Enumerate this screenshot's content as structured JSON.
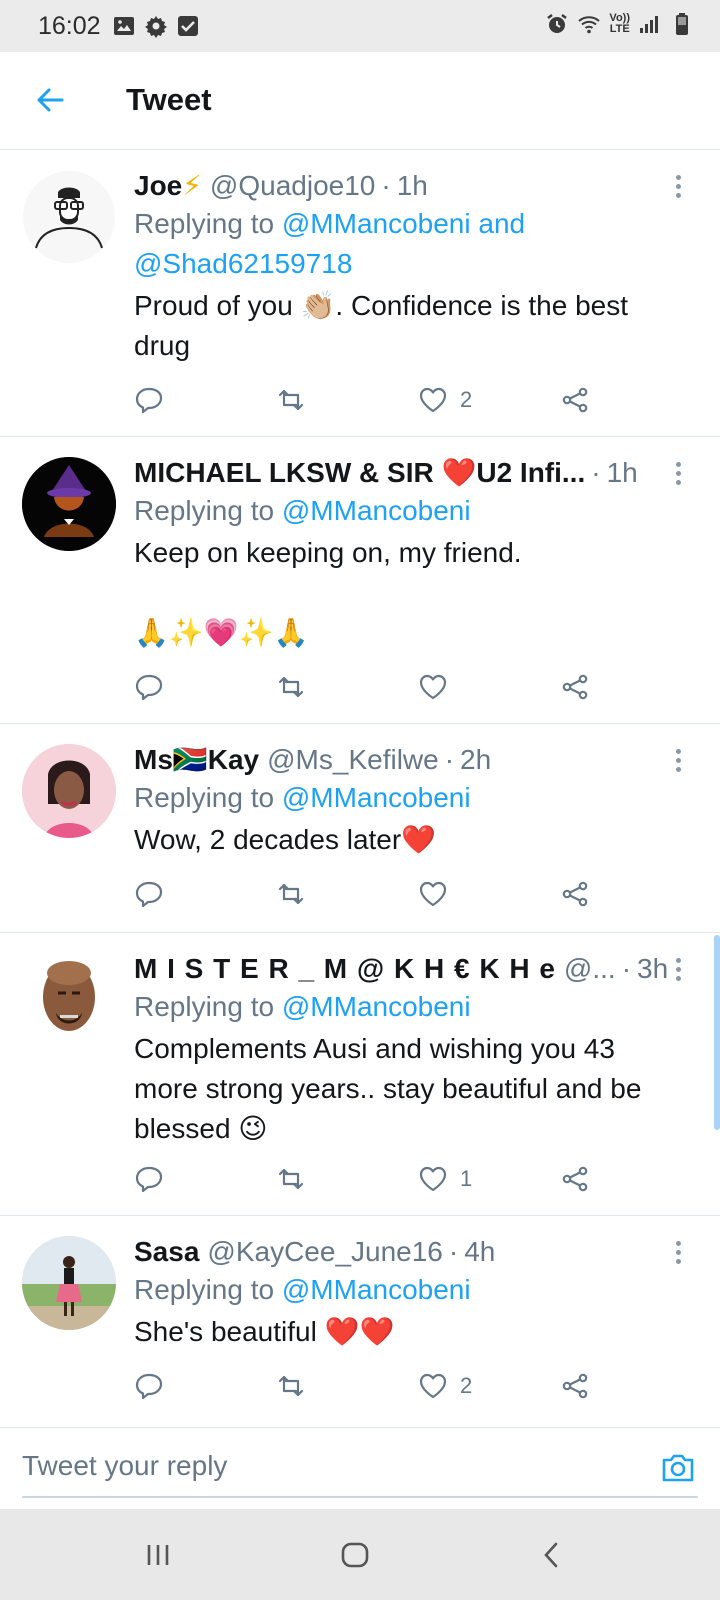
{
  "status_bar": {
    "time": "16:02",
    "lte_top": "Vo))",
    "lte_bottom": "LTE",
    "icons": [
      "image-icon",
      "gear-icon",
      "checkbox-icon",
      "alarm-icon",
      "wifi-icon",
      "signal-icon",
      "battery-icon"
    ]
  },
  "header": {
    "title": "Tweet",
    "back_icon": "arrow-left-icon"
  },
  "colors": {
    "accent": "#1da1f2",
    "text": "#14171a",
    "secondary": "#657786",
    "divider": "#e1e8ed"
  },
  "tweets": [
    {
      "name": "Joe",
      "name_emoji": "⚡",
      "handle": "@Quadjoe10",
      "time": "1h",
      "replying_prefix": "Replying to",
      "mentions": "@MMancobeni and @Shad62159718",
      "text": "Proud of you 👏🏼. Confidence is the best drug",
      "like_count": "2"
    },
    {
      "name": "MICHAEL LKSW & SIR ❤️U2 Infi...",
      "handle": "",
      "time": "1h",
      "replying_prefix": "Replying to",
      "mentions": "@MMancobeni",
      "text": "Keep on keeping on, my friend.",
      "text2": "🙏✨💗✨🙏",
      "like_count": ""
    },
    {
      "name": "Ms🇿🇦Kay",
      "handle": "@Ms_Kefilwe",
      "time": "2h",
      "replying_prefix": "Replying to",
      "mentions": "@MMancobeni",
      "text": "Wow, 2 decades later❤️",
      "like_count": ""
    },
    {
      "name": "M I S T E R _ M @ K H €  K H e",
      "handle": "@...",
      "time": "3h",
      "replying_prefix": "Replying to",
      "mentions": "@MMancobeni",
      "text": "Complements Ausi and wishing you 43 more strong years.. stay beautiful and be blessed 😉",
      "like_count": "1"
    },
    {
      "name": "Sasa",
      "handle": "@KayCee_June16",
      "time": "4h",
      "replying_prefix": "Replying to",
      "mentions": "@MMancobeni",
      "text": "She's beautiful ❤️❤️",
      "like_count": "2"
    }
  ],
  "reply_bar": {
    "placeholder": "Tweet your reply",
    "camera_icon": "camera-icon"
  },
  "nav_bar": {
    "icons": [
      "recents-icon",
      "home-icon",
      "back-icon"
    ]
  }
}
